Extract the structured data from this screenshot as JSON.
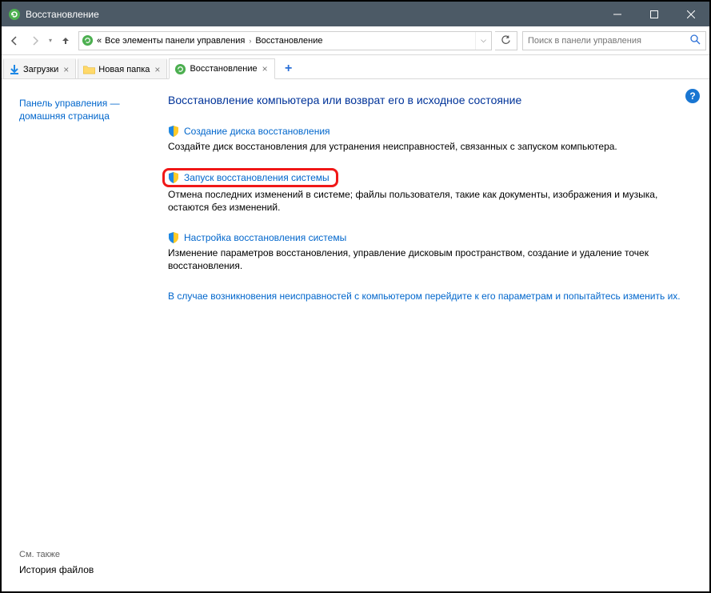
{
  "window": {
    "title": "Восстановление"
  },
  "address": {
    "prefix": "«",
    "seg1": "Все элементы панели управления",
    "seg2": "Восстановление"
  },
  "search": {
    "placeholder": "Поиск в панели управления"
  },
  "tabs": [
    {
      "label": "Загрузки",
      "icon": "download"
    },
    {
      "label": "Новая папка",
      "icon": "folder"
    },
    {
      "label": "Восстановление",
      "icon": "control",
      "active": true
    }
  ],
  "sidebar": {
    "home_line1": "Панель управления —",
    "home_line2": "домашняя страница",
    "see_also": "См. также",
    "history": "История файлов"
  },
  "main": {
    "heading": "Восстановление компьютера или возврат его в исходное состояние",
    "items": [
      {
        "link": "Создание диска восстановления",
        "desc": "Создайте диск восстановления для устранения неисправностей, связанных с запуском компьютера.",
        "highlighted": false
      },
      {
        "link": "Запуск восстановления системы",
        "desc": "Отмена последних изменений в системе; файлы пользователя, такие как документы, изображения и музыка, остаются без изменений.",
        "highlighted": true
      },
      {
        "link": "Настройка восстановления системы",
        "desc": "Изменение параметров восстановления, управление дисковым пространством, создание и удаление точек восстановления.",
        "highlighted": false
      }
    ],
    "footer_link": "В случае возникновения неисправностей с компьютером перейдите к его параметрам и попытайтесь изменить их."
  }
}
